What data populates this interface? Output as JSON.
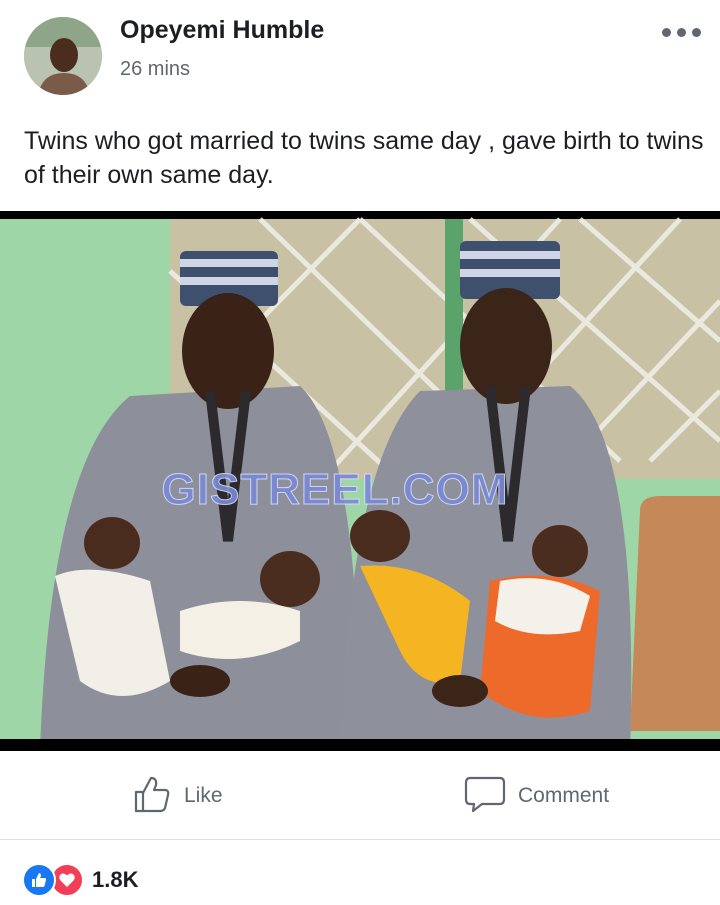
{
  "post": {
    "author": "Opeyemi Humble",
    "time": "26 mins",
    "caption": "Twins who got married to twins same day , gave birth to twins of their own same day.",
    "watermark": "GISTREEL.COM"
  },
  "actions": {
    "like_label": "Like",
    "comment_label": "Comment"
  },
  "reactions": {
    "count": "1.8K",
    "types": [
      "like",
      "love"
    ]
  },
  "icons": {
    "more": "more-dots-icon",
    "like": "thumbs-up-icon",
    "comment": "comment-bubble-icon"
  },
  "colors": {
    "text": "#1c1e21",
    "secondary": "#606770",
    "like_blue": "#1877f2",
    "love_red": "#f33e58"
  }
}
